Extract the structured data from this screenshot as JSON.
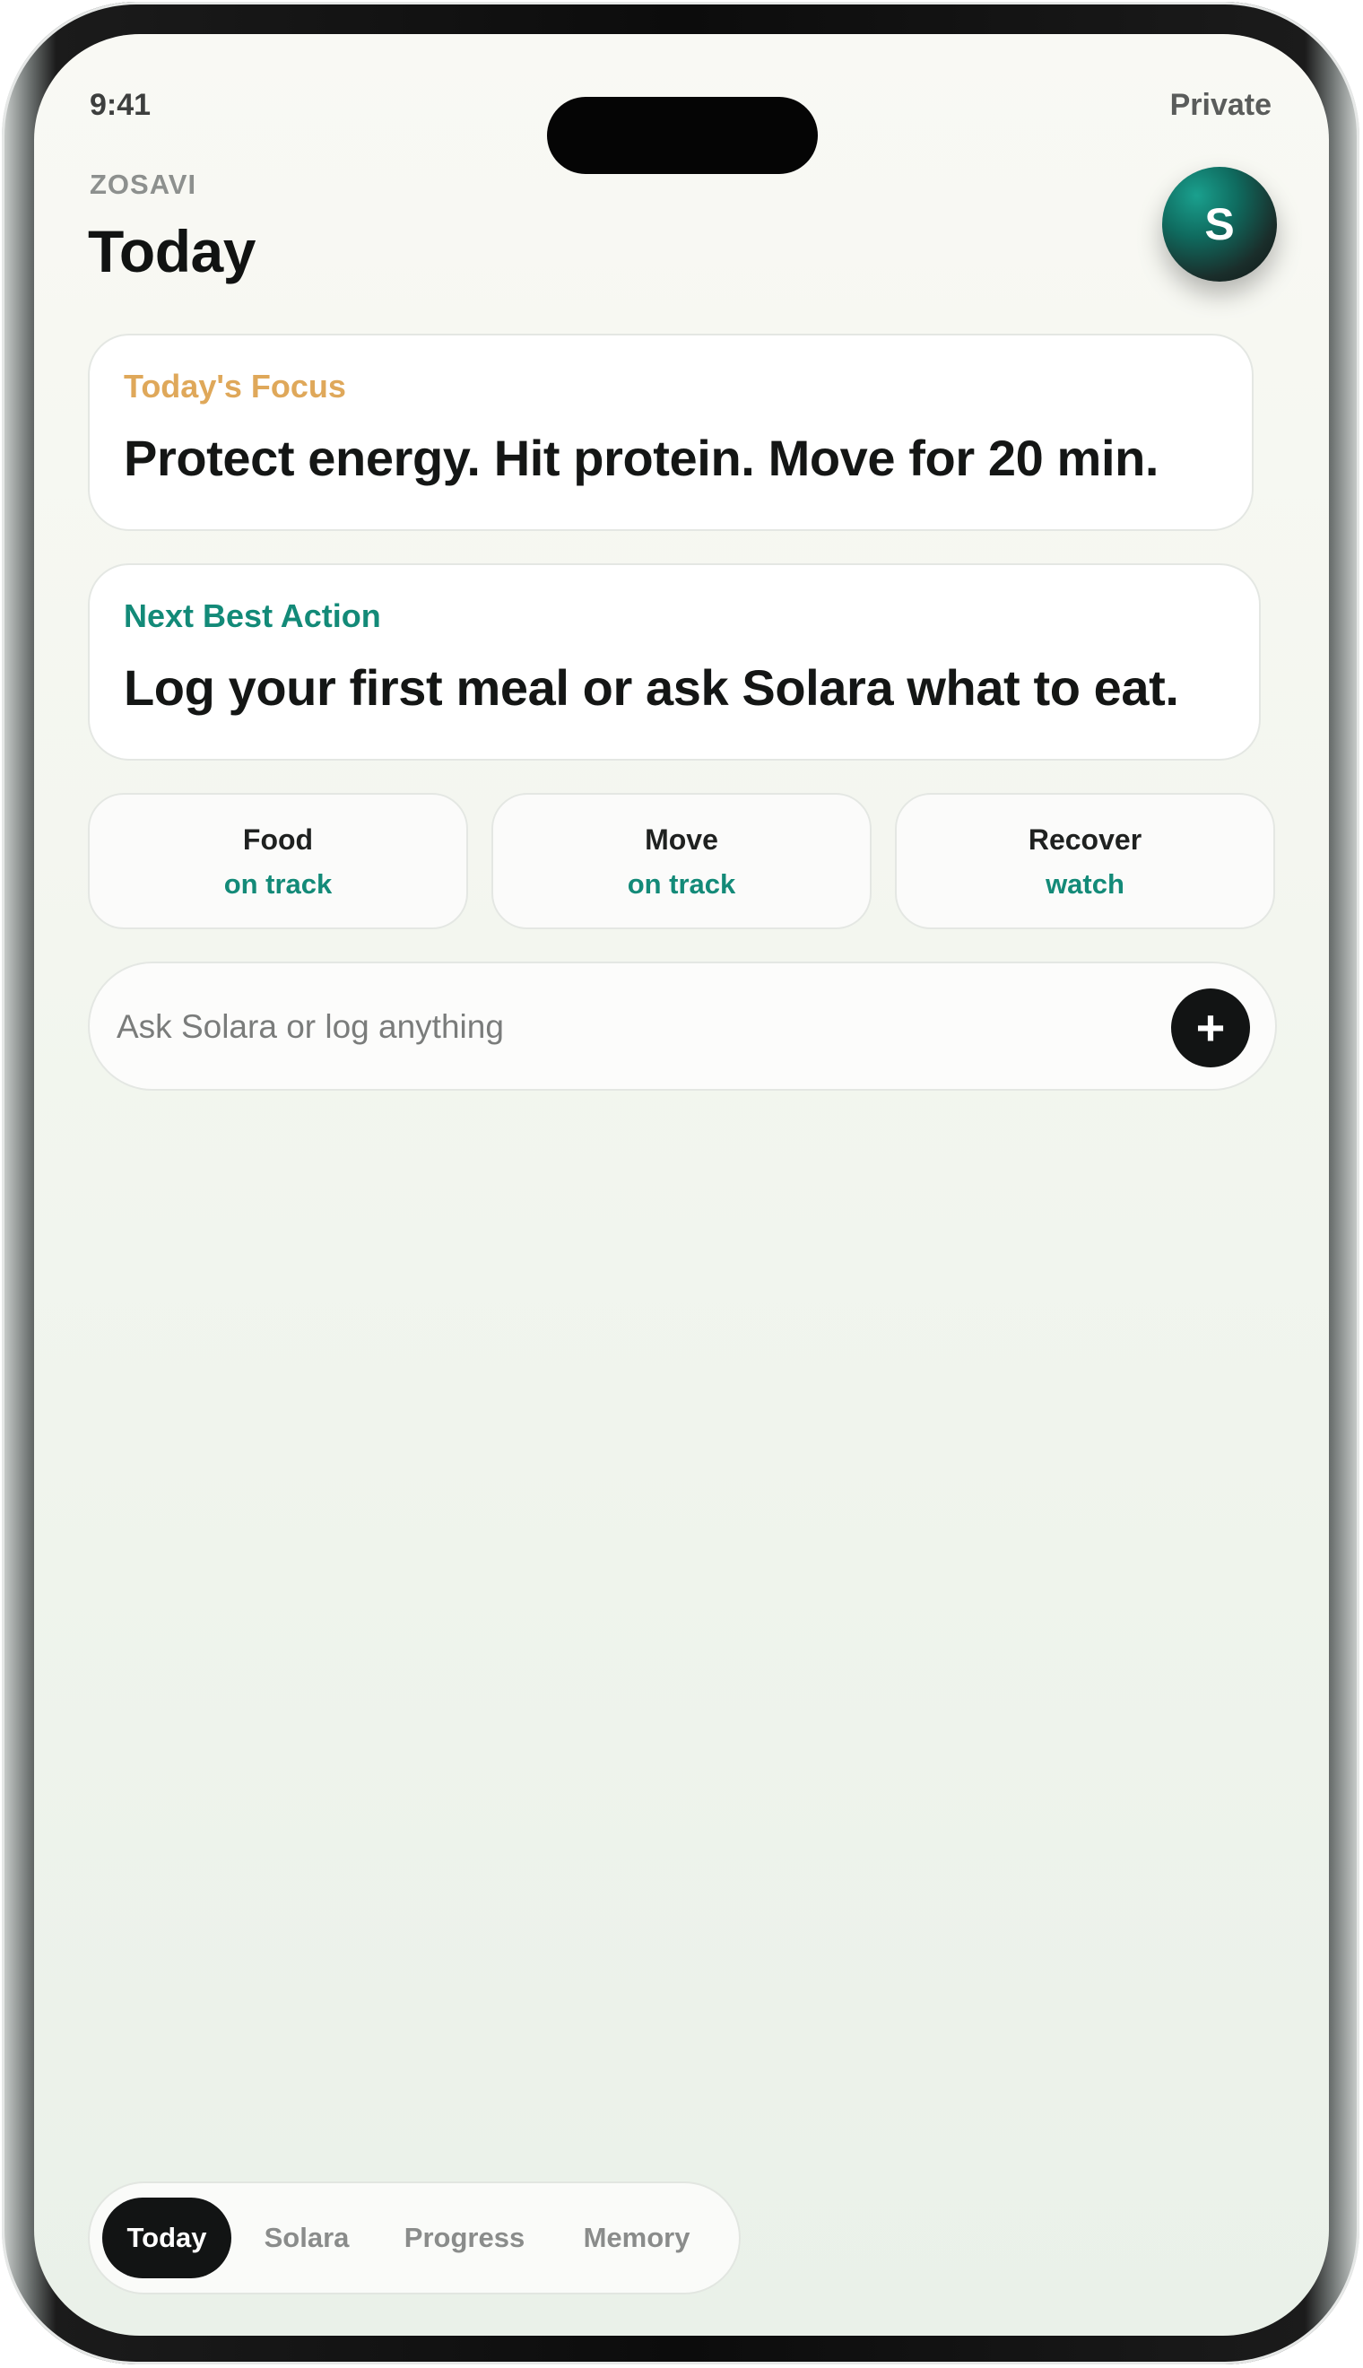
{
  "status_bar": {
    "time": "9:41",
    "privacy": "Private"
  },
  "header": {
    "brand": "ZOSAVI",
    "title": "Today",
    "avatar_initial": "S"
  },
  "focus_card": {
    "label": "Today's Focus",
    "text": "Protect energy. Hit protein. Move for 20 min."
  },
  "action_card": {
    "label": "Next Best Action",
    "text": "Log your first meal or ask Solara what to eat."
  },
  "stats": [
    {
      "title": "Food",
      "status": "on track"
    },
    {
      "title": "Move",
      "status": "on track"
    },
    {
      "title": "Recover",
      "status": "watch"
    }
  ],
  "ask_bar": {
    "placeholder": "Ask Solara or log anything",
    "button_icon": "plus-icon"
  },
  "tabs": [
    {
      "label": "Today",
      "active": true
    },
    {
      "label": "Solara",
      "active": false
    },
    {
      "label": "Progress",
      "active": false
    },
    {
      "label": "Memory",
      "active": false
    }
  ],
  "colors": {
    "accent_teal": "#138a78",
    "accent_gold": "#dfa85a",
    "dark": "#121414"
  }
}
